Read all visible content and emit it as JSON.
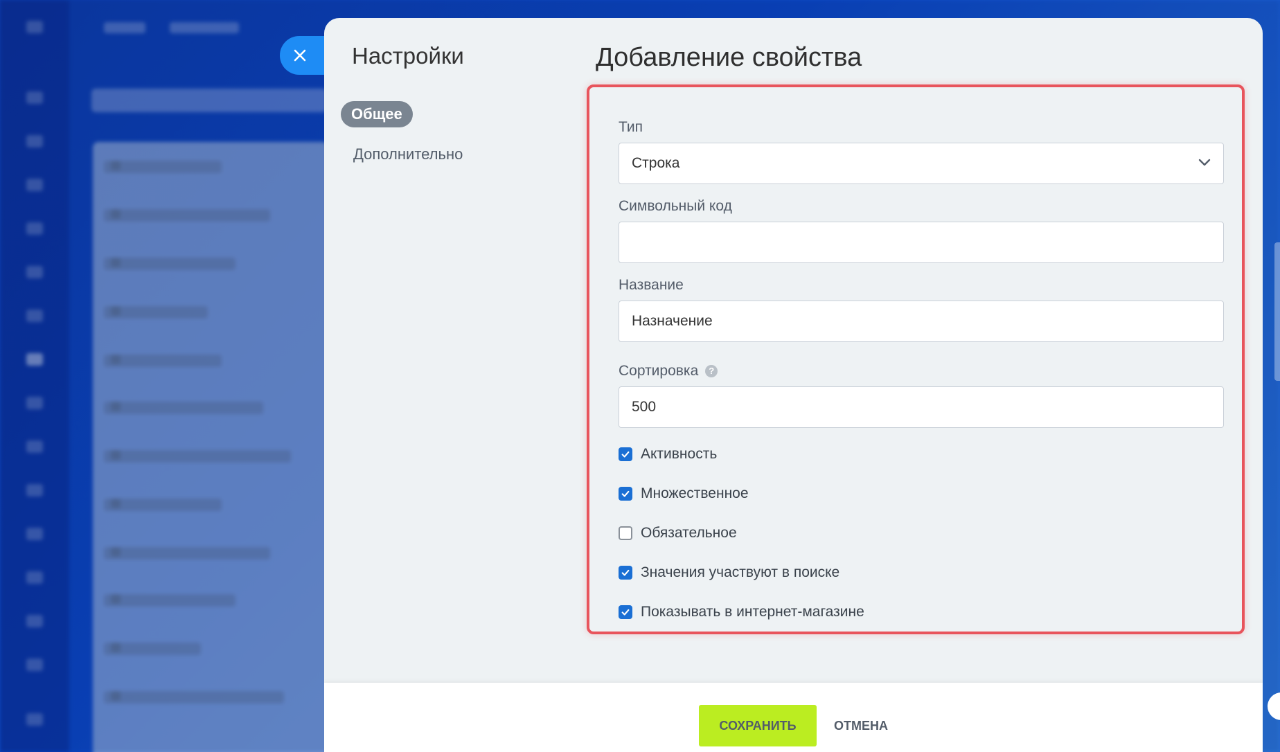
{
  "sidebar": {
    "title": "Настройки",
    "items": [
      {
        "label": "Общее",
        "active": true
      },
      {
        "label": "Дополнительно",
        "active": false
      }
    ]
  },
  "main": {
    "title": "Добавление свойства"
  },
  "form": {
    "type": {
      "label": "Тип",
      "value": "Строка"
    },
    "code": {
      "label": "Символьный код",
      "value": ""
    },
    "name": {
      "label": "Название",
      "value": "Назначение"
    },
    "sort": {
      "label": "Сортировка",
      "value": "500",
      "help": "?"
    },
    "checkboxes": [
      {
        "label": "Активность",
        "checked": true
      },
      {
        "label": "Множественное",
        "checked": true
      },
      {
        "label": "Обязательное",
        "checked": false
      },
      {
        "label": "Значения участвуют в поиске",
        "checked": true
      },
      {
        "label": "Показывать в интернет-магазине",
        "checked": true
      }
    ]
  },
  "footer": {
    "save_label": "СОХРАНИТЬ",
    "cancel_label": "ОТМЕНА"
  },
  "colors": {
    "accent": "#1a6fd4",
    "highlight": "#e8545c",
    "save": "#bbed21"
  }
}
